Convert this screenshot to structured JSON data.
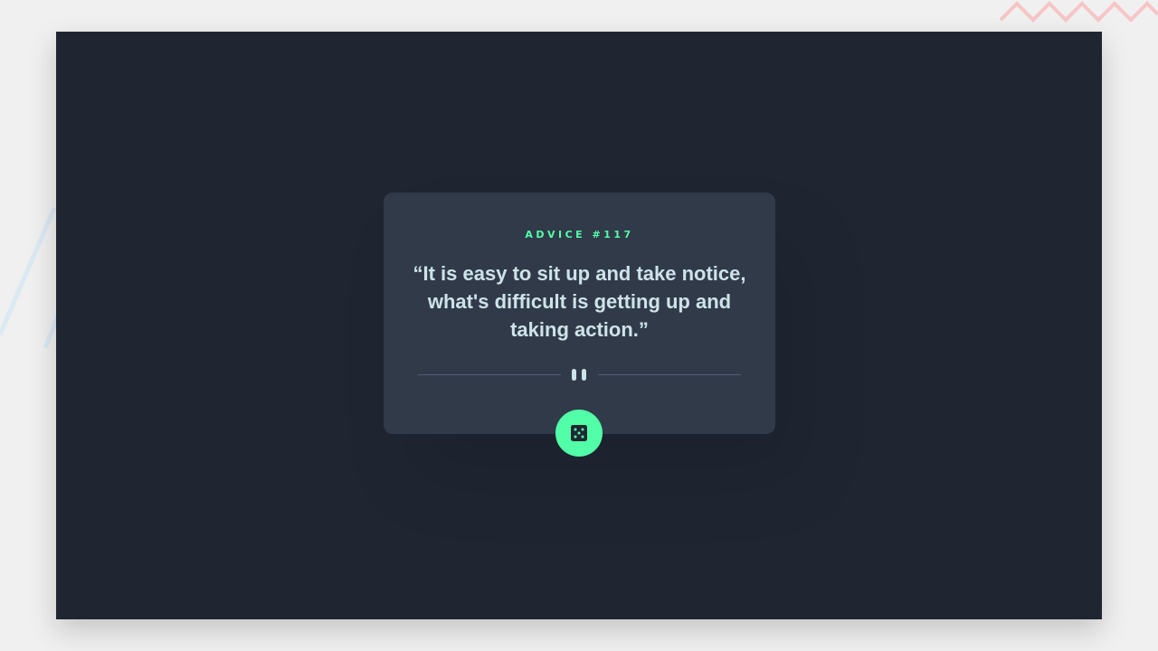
{
  "card": {
    "advice_id_label": "ADVICE #117",
    "quote": "“It is easy to sit up and take notice, what's difficult is getting up and taking action.”"
  },
  "icons": {
    "divider": "pause-icon",
    "button": "dice-icon"
  },
  "colors": {
    "accent": "#52ffa8",
    "frame_bg": "#1f2632",
    "card_bg": "#313a49",
    "text": "#cee3e9",
    "divider": "#4f5d74",
    "outer_bg": "#f0f0f0",
    "deco_pink": "#f7c5c5",
    "deco_blue": "#dbe9f3"
  }
}
